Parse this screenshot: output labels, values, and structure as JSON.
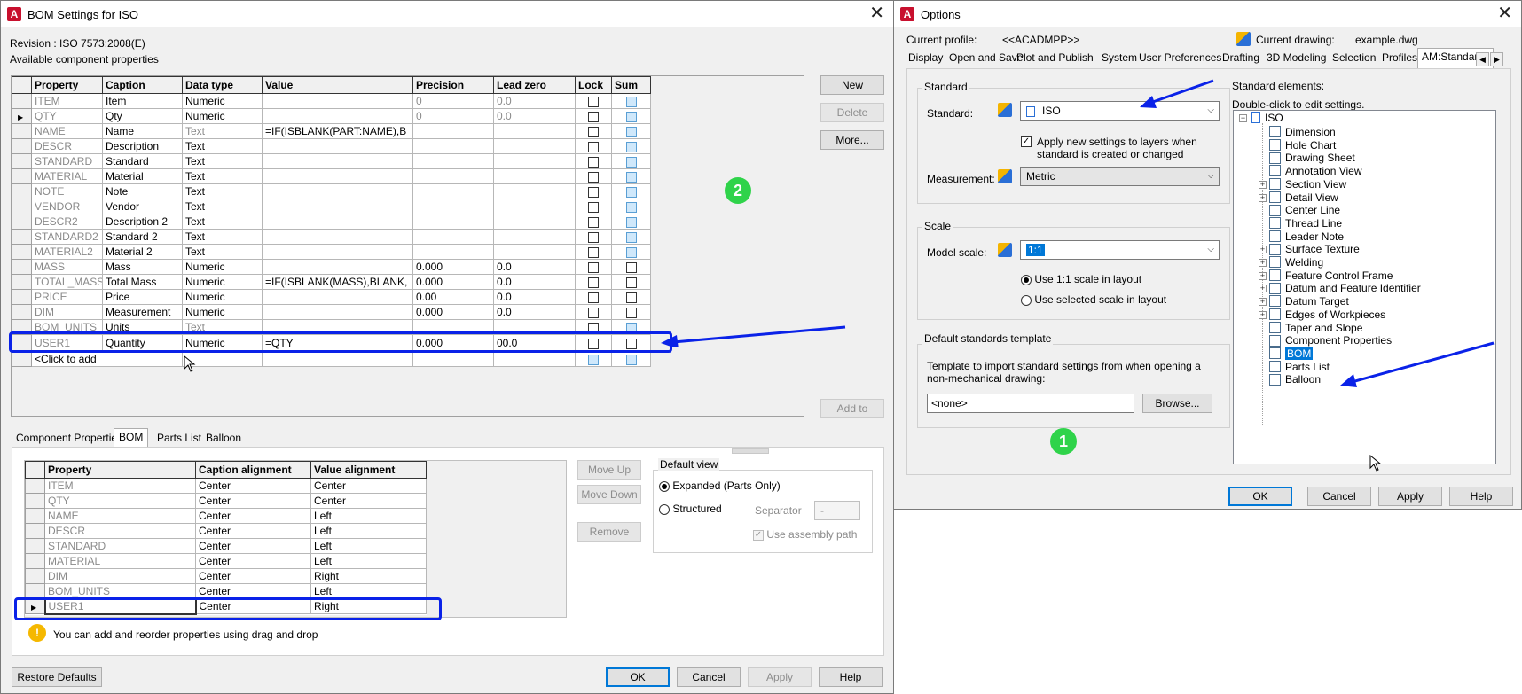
{
  "bom_dialog": {
    "title": "BOM Settings for ISO",
    "revision": "Revision : ISO 7573:2008(E)",
    "available_label": "Available component properties",
    "columns": [
      "Property",
      "Caption",
      "Data type",
      "Value",
      "Precision",
      "Lead zero",
      "Lock",
      "Sum"
    ],
    "rows": [
      {
        "property": "ITEM",
        "caption": "Item",
        "datatype": "Numeric",
        "value": "",
        "precision": "0",
        "leadzero": "0.0"
      },
      {
        "property": "QTY",
        "caption": "Qty",
        "datatype": "Numeric",
        "value": "",
        "precision": "0",
        "leadzero": "0.0"
      },
      {
        "property": "NAME",
        "caption": "Name",
        "datatype": "Text",
        "value": "=IF(ISBLANK(PART:NAME),B",
        "precision": "",
        "leadzero": ""
      },
      {
        "property": "DESCR",
        "caption": "Description",
        "datatype": "Text",
        "value": "",
        "precision": "",
        "leadzero": ""
      },
      {
        "property": "STANDARD",
        "caption": "Standard",
        "datatype": "Text",
        "value": "",
        "precision": "",
        "leadzero": ""
      },
      {
        "property": "MATERIAL",
        "caption": "Material",
        "datatype": "Text",
        "value": "",
        "precision": "",
        "leadzero": ""
      },
      {
        "property": "NOTE",
        "caption": "Note",
        "datatype": "Text",
        "value": "",
        "precision": "",
        "leadzero": ""
      },
      {
        "property": "VENDOR",
        "caption": "Vendor",
        "datatype": "Text",
        "value": "",
        "precision": "",
        "leadzero": ""
      },
      {
        "property": "DESCR2",
        "caption": "Description 2",
        "datatype": "Text",
        "value": "",
        "precision": "",
        "leadzero": ""
      },
      {
        "property": "STANDARD2",
        "caption": "Standard 2",
        "datatype": "Text",
        "value": "",
        "precision": "",
        "leadzero": ""
      },
      {
        "property": "MATERIAL2",
        "caption": "Material 2",
        "datatype": "Text",
        "value": "",
        "precision": "",
        "leadzero": ""
      },
      {
        "property": "MASS",
        "caption": "Mass",
        "datatype": "Numeric",
        "value": "",
        "precision": "0.000",
        "leadzero": "0.0"
      },
      {
        "property": "TOTAL_MASS",
        "caption": "Total Mass",
        "datatype": "Numeric",
        "value": "=IF(ISBLANK(MASS),BLANK,",
        "precision": "0.000",
        "leadzero": "0.0"
      },
      {
        "property": "PRICE",
        "caption": "Price",
        "datatype": "Numeric",
        "value": "",
        "precision": "0.00",
        "leadzero": "0.0"
      },
      {
        "property": "DIM",
        "caption": "Measurement",
        "datatype": "Numeric",
        "value": "",
        "precision": "0.000",
        "leadzero": "0.0"
      },
      {
        "property": "BOM_UNITS",
        "caption": "Units",
        "datatype": "Text",
        "value": "",
        "precision": "",
        "leadzero": ""
      },
      {
        "property": "USER1",
        "caption": "Quantity",
        "datatype": "Numeric",
        "value": "=QTY",
        "precision": "0.000",
        "leadzero": "00.0"
      },
      {
        "property": "<Click to add",
        "caption": "",
        "datatype": "",
        "value": "",
        "precision": "",
        "leadzero": ""
      }
    ],
    "buttons": {
      "new": "New",
      "delete": "Delete",
      "more": "More...",
      "add_to": "Add to"
    },
    "tabs": [
      "Component Properties",
      "BOM",
      "Parts List",
      "Balloon"
    ],
    "align_columns": [
      "Property",
      "Caption alignment",
      "Value alignment"
    ],
    "align_rows": [
      {
        "property": "ITEM",
        "caption": "Center",
        "value": "Center"
      },
      {
        "property": "QTY",
        "caption": "Center",
        "value": "Center"
      },
      {
        "property": "NAME",
        "caption": "Center",
        "value": "Left"
      },
      {
        "property": "DESCR",
        "caption": "Center",
        "value": "Left"
      },
      {
        "property": "STANDARD",
        "caption": "Center",
        "value": "Left"
      },
      {
        "property": "MATERIAL",
        "caption": "Center",
        "value": "Left"
      },
      {
        "property": "DIM",
        "caption": "Center",
        "value": "Right"
      },
      {
        "property": "BOM_UNITS",
        "caption": "Center",
        "value": "Left"
      },
      {
        "property": "USER1",
        "caption": "Center",
        "value": "Right"
      }
    ],
    "move_up": "Move Up",
    "move_down": "Move Down",
    "remove": "Remove",
    "default_view": {
      "label": "Default view",
      "expanded": "Expanded (Parts Only)",
      "structured": "Structured",
      "separator_label": "Separator",
      "separator_value": "-",
      "use_assembly_path": "Use assembly path"
    },
    "hint": "You can add and reorder properties using drag and drop",
    "restore_defaults": "Restore Defaults",
    "ok": "OK",
    "cancel": "Cancel",
    "apply": "Apply",
    "help": "Help",
    "badge": "2"
  },
  "options_dialog": {
    "title": "Options",
    "current_profile_label": "Current profile:",
    "current_profile_value": "<<ACADMPP>>",
    "current_drawing_label": "Current drawing:",
    "current_drawing_value": "example.dwg",
    "tabs": [
      "Display",
      "Open and Save",
      "Plot and Publish",
      "System",
      "User Preferences",
      "Drafting",
      "3D Modeling",
      "Selection",
      "Profiles",
      "AM:Standards"
    ],
    "standard_group": "Standard",
    "standard_label": "Standard:",
    "standard_value": "ISO",
    "apply_layers_text": "Apply new settings to layers when standard is created or changed",
    "measurement_label": "Measurement:",
    "measurement_value": "Metric",
    "scale_group": "Scale",
    "model_scale_label": "Model scale:",
    "model_scale_value": "1:1",
    "use_11_scale": "Use 1:1 scale in layout",
    "use_selected_scale": "Use selected scale in layout",
    "template_group": "Default standards template",
    "template_text": "Template to import standard settings from when opening a non-mechanical drawing:",
    "template_value": "<none>",
    "browse": "Browse...",
    "elements_label": "Standard elements:",
    "elements_hint": "Double-click to edit settings.",
    "tree_root": "ISO",
    "tree_items": [
      "Dimension",
      "Hole Chart",
      "Drawing Sheet",
      "Annotation View",
      "Section View",
      "Detail View",
      "Center Line",
      "Thread Line",
      "Leader Note",
      "Surface Texture",
      "Welding",
      "Feature Control Frame",
      "Datum and Feature Identifier",
      "Datum Target",
      "Edges of Workpieces",
      "Taper and Slope",
      "Component Properties",
      "BOM",
      "Parts List",
      "Balloon"
    ],
    "ok": "OK",
    "cancel": "Cancel",
    "apply": "Apply",
    "help": "Help",
    "badge": "1"
  },
  "colors": {
    "annotation_blue": "#0a22e8",
    "badge_green": "#2fd34a",
    "selection_blue": "#0078d7"
  }
}
